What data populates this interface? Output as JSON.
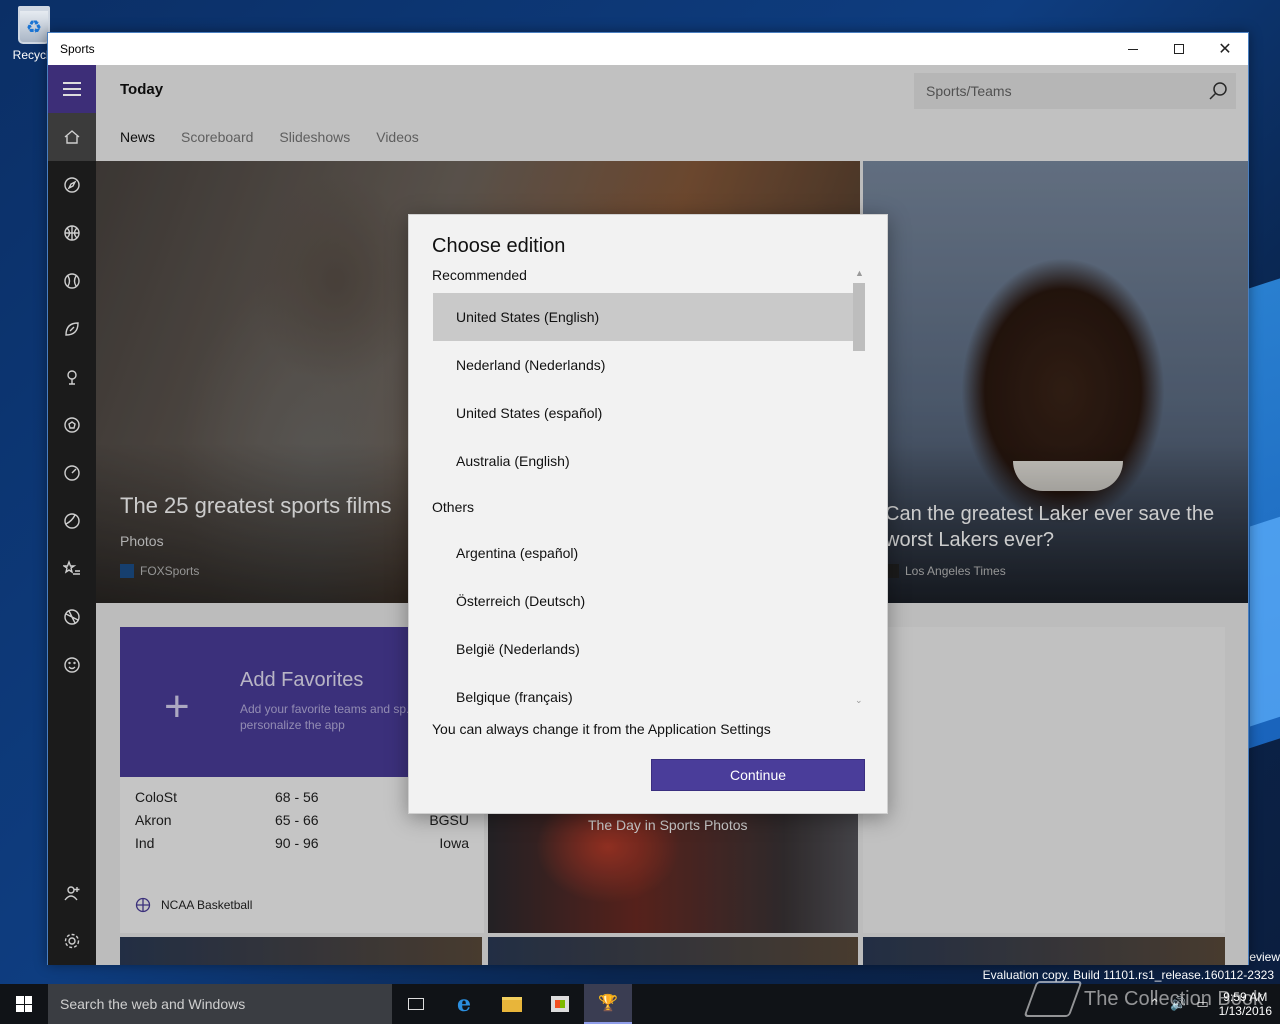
{
  "desktop": {
    "recycle_bin_label": "Recycle",
    "eval_text": "Evaluation copy. Build 11101.rs1_release.160112-2323",
    "eval_clip": "eview"
  },
  "window": {
    "title": "Sports"
  },
  "header": {
    "today_label": "Today",
    "search_placeholder": "Sports/Teams",
    "tabs": [
      "News",
      "Scoreboard",
      "Slideshows",
      "Videos"
    ]
  },
  "rail": {
    "icons": [
      "home-icon",
      "compass-icon",
      "basketball-icon",
      "baseball-icon",
      "football-icon",
      "golf-icon",
      "soccer-icon",
      "racing-icon",
      "tennis-icon",
      "favorites-star-icon",
      "sports-ball-icon",
      "smiley-icon"
    ],
    "bottom_icons": [
      "account-icon",
      "settings-gear-icon"
    ]
  },
  "hero1": {
    "title": "The 25 greatest sports films",
    "subtitle": "Photos",
    "source": "FOXSports"
  },
  "hero2": {
    "title": "Can the greatest Laker ever save the worst Lakers ever?",
    "source": "Los Angeles Times"
  },
  "favorites": {
    "title": "Add Favorites",
    "description": "Add your favorite teams and sp... personalize the app"
  },
  "scores": {
    "rows": [
      {
        "team1": "ColoSt",
        "score": "68  -  56",
        "team2": ""
      },
      {
        "team1": "Akron",
        "score": "65  -  66",
        "team2": "BGSU"
      },
      {
        "team1": "Ind",
        "score": "90  -  96",
        "team2": "Iowa"
      }
    ],
    "league": "NCAA Basketball"
  },
  "photos": {
    "caption": "The Day in Sports Photos"
  },
  "dialog": {
    "title": "Choose edition",
    "recommended_label": "Recommended",
    "recommended": [
      "United States (English)",
      "Nederland (Nederlands)",
      "United States (español)",
      "Australia (English)"
    ],
    "others_label": "Others",
    "others": [
      "Argentina (español)",
      "Österreich (Deutsch)",
      "België (Nederlands)",
      "Belgique (français)"
    ],
    "selected": "United States (English)",
    "note": "You can always change it from the Application Settings",
    "continue_label": "Continue"
  },
  "taskbar": {
    "search_placeholder": "Search the web and Windows",
    "time": "9:59 AM",
    "date": "1/13/2016",
    "watermark": "The Collection Book"
  }
}
